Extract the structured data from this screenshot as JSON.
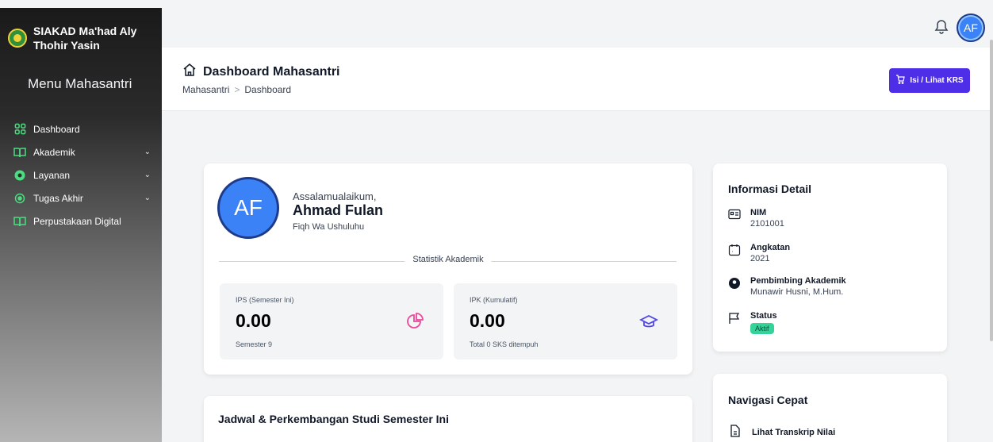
{
  "sidebar": {
    "brand": "SIAKAD Ma'had Aly Thohir Yasin",
    "menu_title": "Menu Mahasantri",
    "items": [
      {
        "label": "Dashboard",
        "icon": "grid-icon",
        "expandable": false
      },
      {
        "label": "Akademik",
        "icon": "book-open-icon",
        "expandable": true
      },
      {
        "label": "Layanan",
        "icon": "gear-icon",
        "expandable": true
      },
      {
        "label": "Tugas Akhir",
        "icon": "sun-icon",
        "expandable": true
      },
      {
        "label": "Perpustakaan Digital",
        "icon": "book-open-icon",
        "expandable": false
      }
    ]
  },
  "topbar": {
    "avatar": "AF"
  },
  "header": {
    "title": "Dashboard Mahasantri",
    "breadcrumb": [
      "Mahasantri",
      "Dashboard"
    ],
    "krs_button": "Isi / Lihat KRS"
  },
  "profile": {
    "avatar": "AF",
    "greeting": "Assalamualaikum,",
    "name": "Ahmad Fulan",
    "major": "Fiqh Wa Ushuluhu",
    "stats_heading": "Statistik Akademik",
    "ips": {
      "label": "IPS (Semester Ini)",
      "value": "0.00",
      "sub": "Semester 9",
      "icon": "pie-chart-icon",
      "color": "#ec4899"
    },
    "ipk": {
      "label": "IPK (Kumulatif)",
      "value": "0.00",
      "sub": "Total 0 SKS ditempuh",
      "icon": "graduation-cap-icon",
      "color": "#4f46e5"
    }
  },
  "jadwal": {
    "title": "Jadwal & Perkembangan Studi Semester Ini"
  },
  "info": {
    "title": "Informasi Detail",
    "nim_label": "NIM",
    "nim_value": "2101001",
    "angkatan_label": "Angkatan",
    "angkatan_value": "2021",
    "pembimbing_label": "Pembimbing Akademik",
    "pembimbing_value": "Munawir Husni, M.Hum.",
    "status_label": "Status",
    "status_value": "Aktif"
  },
  "nav": {
    "title": "Navigasi Cepat",
    "links": [
      "Lihat Transkrip Nilai"
    ]
  },
  "colors": {
    "primary": "#4f2ee8",
    "avatar": "#3b82f6",
    "status_active": "#34d399",
    "sidebar_icon": "#4ade80"
  }
}
